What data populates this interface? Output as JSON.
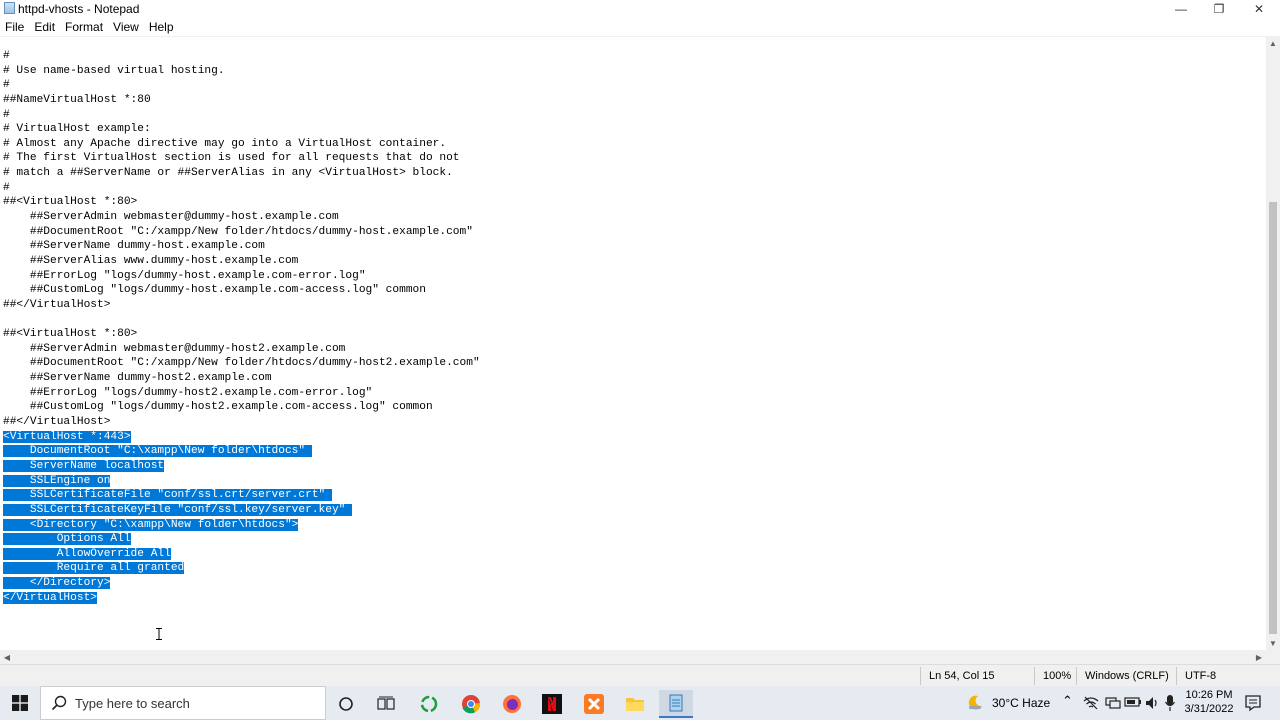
{
  "window": {
    "title": "httpd-vhosts - Notepad",
    "minimize": "—",
    "maximize": "❐",
    "close": "✕"
  },
  "menu": [
    "File",
    "Edit",
    "Format",
    "View",
    "Help"
  ],
  "editor": {
    "selection_color": "#0078d7",
    "lines": [
      {
        "text": "#",
        "selected": false
      },
      {
        "text": "# Use name-based virtual hosting.",
        "selected": false
      },
      {
        "text": "#",
        "selected": false
      },
      {
        "text": "##NameVirtualHost *:80",
        "selected": false
      },
      {
        "text": "#",
        "selected": false
      },
      {
        "text": "# VirtualHost example:",
        "selected": false
      },
      {
        "text": "# Almost any Apache directive may go into a VirtualHost container.",
        "selected": false
      },
      {
        "text": "# The first VirtualHost section is used for all requests that do not",
        "selected": false
      },
      {
        "text": "# match a ##ServerName or ##ServerAlias in any <VirtualHost> block.",
        "selected": false
      },
      {
        "text": "#",
        "selected": false
      },
      {
        "text": "##<VirtualHost *:80>",
        "selected": false
      },
      {
        "text": "    ##ServerAdmin webmaster@dummy-host.example.com",
        "selected": false
      },
      {
        "text": "    ##DocumentRoot \"C:/xampp/New folder/htdocs/dummy-host.example.com\"",
        "selected": false
      },
      {
        "text": "    ##ServerName dummy-host.example.com",
        "selected": false
      },
      {
        "text": "    ##ServerAlias www.dummy-host.example.com",
        "selected": false
      },
      {
        "text": "    ##ErrorLog \"logs/dummy-host.example.com-error.log\"",
        "selected": false
      },
      {
        "text": "    ##CustomLog \"logs/dummy-host.example.com-access.log\" common",
        "selected": false
      },
      {
        "text": "##</VirtualHost>",
        "selected": false
      },
      {
        "text": "",
        "selected": false
      },
      {
        "text": "##<VirtualHost *:80>",
        "selected": false
      },
      {
        "text": "    ##ServerAdmin webmaster@dummy-host2.example.com",
        "selected": false
      },
      {
        "text": "    ##DocumentRoot \"C:/xampp/New folder/htdocs/dummy-host2.example.com\"",
        "selected": false
      },
      {
        "text": "    ##ServerName dummy-host2.example.com",
        "selected": false
      },
      {
        "text": "    ##ErrorLog \"logs/dummy-host2.example.com-error.log\"",
        "selected": false
      },
      {
        "text": "    ##CustomLog \"logs/dummy-host2.example.com-access.log\" common",
        "selected": false
      },
      {
        "text": "##</VirtualHost>",
        "selected": false
      },
      {
        "text": "<VirtualHost *:443>",
        "selected": true
      },
      {
        "text": "    DocumentRoot \"C:\\xampp\\New folder\\htdocs\" ",
        "selected": true
      },
      {
        "text": "    ServerName localhost",
        "selected": true
      },
      {
        "text": "    SSLEngine on",
        "selected": true
      },
      {
        "text": "    SSLCertificateFile \"conf/ssl.crt/server.crt\" ",
        "selected": true
      },
      {
        "text": "    SSLCertificateKeyFile \"conf/ssl.key/server.key\" ",
        "selected": true
      },
      {
        "text": "    <Directory \"C:\\xampp\\New folder\\htdocs\">",
        "selected": true
      },
      {
        "text": "        Options All",
        "selected": true
      },
      {
        "text": "        AllowOverride All",
        "selected": true
      },
      {
        "text": "        Require all granted",
        "selected": true
      },
      {
        "text": "    </Directory>",
        "selected": true
      },
      {
        "text": "</VirtualHost>",
        "selected": true
      }
    ]
  },
  "status": {
    "position": "Ln 54, Col 15",
    "zoom": "100%",
    "line_ending": "Windows (CRLF)",
    "encoding": "UTF-8"
  },
  "taskbar": {
    "search_placeholder": "Type here to search",
    "weather": "30°C  Haze",
    "time": "10:26 PM",
    "date": "3/31/2022"
  }
}
